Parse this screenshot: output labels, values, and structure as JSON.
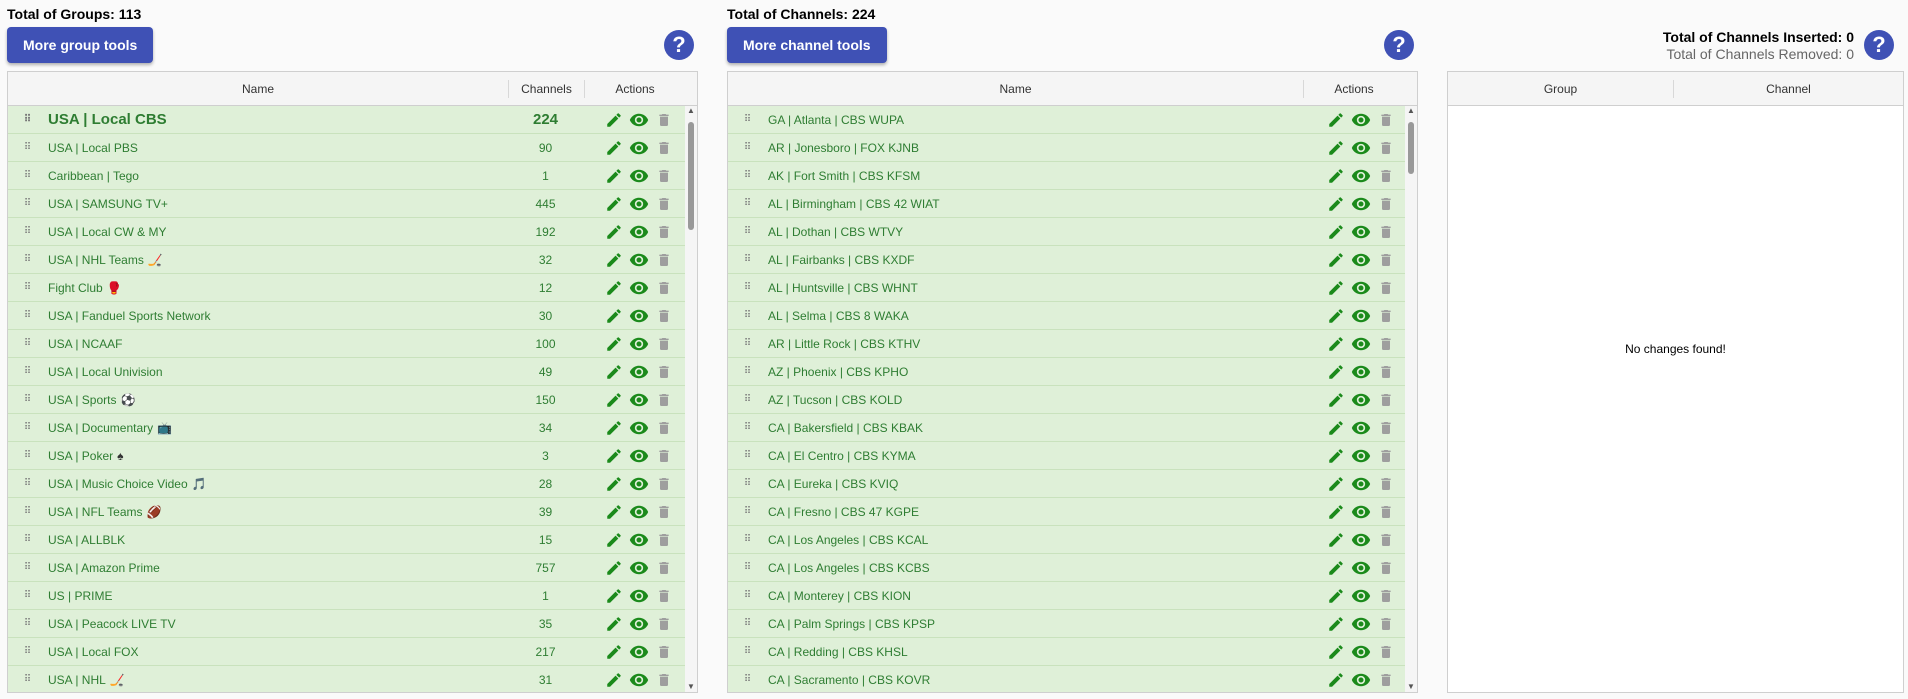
{
  "groups": {
    "total_label": "Total of Groups: 113",
    "tools_button": "More group tools",
    "help_icon": "?",
    "columns": {
      "name": "Name",
      "channels": "Channels",
      "actions": "Actions"
    },
    "rows": [
      {
        "name": "USA | Local CBS",
        "emoji": "",
        "channels": "224"
      },
      {
        "name": "USA | Local PBS",
        "emoji": "",
        "channels": "90"
      },
      {
        "name": "Caribbean | Tego",
        "emoji": "",
        "channels": "1"
      },
      {
        "name": "USA | SAMSUNG TV+",
        "emoji": "",
        "channels": "445"
      },
      {
        "name": "USA | Local CW & MY",
        "emoji": "",
        "channels": "192"
      },
      {
        "name": "USA | NHL Teams",
        "emoji": "🏒",
        "channels": "32"
      },
      {
        "name": "Fight Club",
        "emoji": "🥊",
        "channels": "12"
      },
      {
        "name": "USA | Fanduel Sports Network",
        "emoji": "",
        "channels": "30"
      },
      {
        "name": "USA | NCAAF",
        "emoji": "",
        "channels": "100"
      },
      {
        "name": "USA | Local Univision",
        "emoji": "",
        "channels": "49"
      },
      {
        "name": "USA | Sports",
        "emoji": "⚽",
        "channels": "150"
      },
      {
        "name": "USA | Documentary",
        "emoji": "📺",
        "channels": "34"
      },
      {
        "name": "USA | Poker",
        "emoji": "♠",
        "channels": "3"
      },
      {
        "name": "USA | Music Choice Video",
        "emoji": "🎵",
        "channels": "28"
      },
      {
        "name": "USA | NFL Teams",
        "emoji": "🏈",
        "channels": "39"
      },
      {
        "name": "USA | ALLBLK",
        "emoji": "",
        "channels": "15"
      },
      {
        "name": "USA | Amazon Prime",
        "emoji": "",
        "channels": "757"
      },
      {
        "name": "US | PRIME",
        "emoji": "",
        "channels": "1"
      },
      {
        "name": "USA | Peacock LIVE TV",
        "emoji": "",
        "channels": "35"
      },
      {
        "name": "USA | Local FOX",
        "emoji": "",
        "channels": "217"
      },
      {
        "name": "USA | NHL",
        "emoji": "🏒",
        "channels": "31"
      }
    ]
  },
  "channels": {
    "total_label": "Total of Channels: 224",
    "tools_button": "More channel tools",
    "help_icon": "?",
    "columns": {
      "name": "Name",
      "actions": "Actions"
    },
    "rows": [
      "GA | Atlanta | CBS WUPA",
      "AR | Jonesboro | FOX KJNB",
      "AK | Fort Smith | CBS KFSM",
      "AL | Birmingham | CBS 42 WIAT",
      "AL | Dothan | CBS WTVY",
      "AL | Fairbanks | CBS KXDF",
      "AL | Huntsville | CBS WHNT",
      "AL | Selma | CBS 8 WAKA",
      "AR | Little Rock | CBS KTHV",
      "AZ | Phoenix | CBS KPHO",
      "AZ | Tucson | CBS KOLD",
      "CA | Bakersfield | CBS KBAK",
      "CA | El Centro | CBS KYMA",
      "CA | Eureka | CBS KVIQ",
      "CA | Fresno | CBS 47 KGPE",
      "CA | Los Angeles | CBS KCAL",
      "CA | Los Angeles | CBS KCBS",
      "CA | Monterey | CBS KION",
      "CA | Palm Springs | CBS KPSP",
      "CA | Redding | CBS KHSL",
      "CA | Sacramento | CBS KOVR"
    ]
  },
  "changes": {
    "inserted_label": "Total of Channels Inserted: 0",
    "removed_label": "Total of Channels Removed: 0",
    "help_icon": "?",
    "columns": {
      "group": "Group",
      "channel": "Channel"
    },
    "empty_message": "No changes found!"
  },
  "icons": {
    "drag": "drag-handle-icon",
    "edit": "pencil-icon",
    "view": "eye-icon",
    "delete": "trash-icon"
  },
  "colors": {
    "accent": "#3f51b5",
    "row_bg": "#dff0d8",
    "row_text": "#2e7d32",
    "edit": "#1b8a1b",
    "delete": "#9e9e9e"
  }
}
